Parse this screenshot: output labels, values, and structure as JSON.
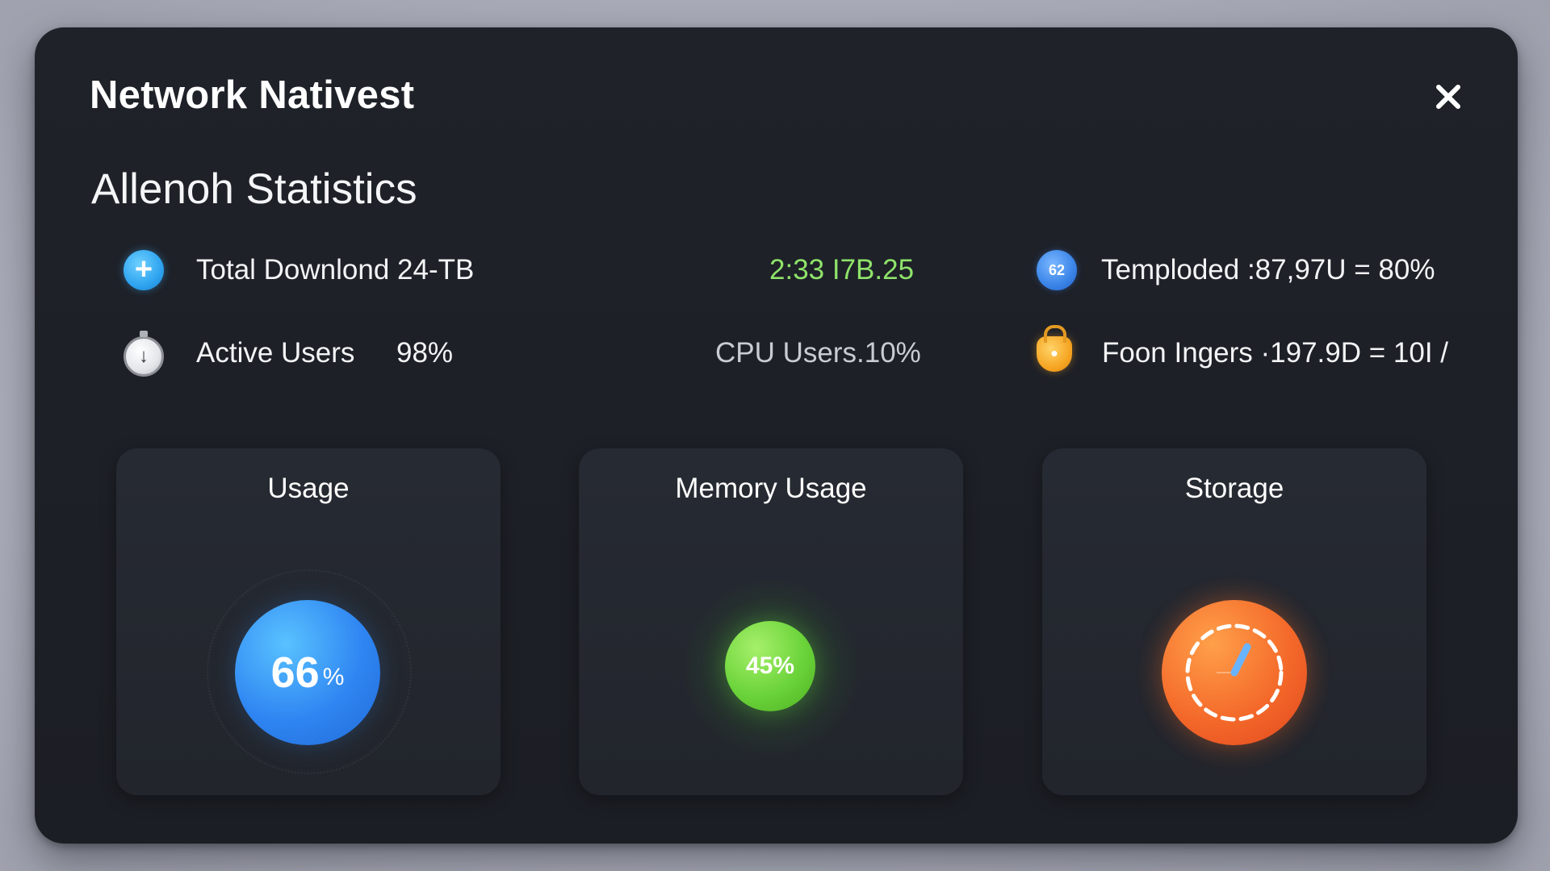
{
  "window": {
    "title": "Network Nativest",
    "close_label": "×"
  },
  "section": {
    "title": "Allenoh Statistics"
  },
  "stats": {
    "row1": {
      "left_icon": "plus-icon",
      "left_text": "Total Downlond 24-TB",
      "middle_text": "2:33 I7B.25",
      "right_icon": "badge-icon",
      "right_badge": "62",
      "right_text": "Temploded :87,97U = 80%"
    },
    "row2": {
      "left_icon": "stopwatch-icon",
      "left_label": "Active Users",
      "left_value": "98%",
      "middle_text": "CPU Users.10%",
      "right_icon": "lock-icon",
      "right_text": "Foon Ingers ·197.9D = 10I /"
    }
  },
  "cards": [
    {
      "title": "Usage",
      "value": "66",
      "unit": "%",
      "color": "#2f86f2"
    },
    {
      "title": "Memory Usage",
      "value": "45%",
      "color": "#6bd33a"
    },
    {
      "title": "Storage",
      "value": "",
      "icon": "dial-icon",
      "color": "#f46a2a"
    }
  ],
  "colors": {
    "background": "#1d2026",
    "card": "#252830",
    "accent_green": "#8fe36a",
    "accent_blue": "#2f86f2",
    "accent_orange": "#f46a2a"
  }
}
